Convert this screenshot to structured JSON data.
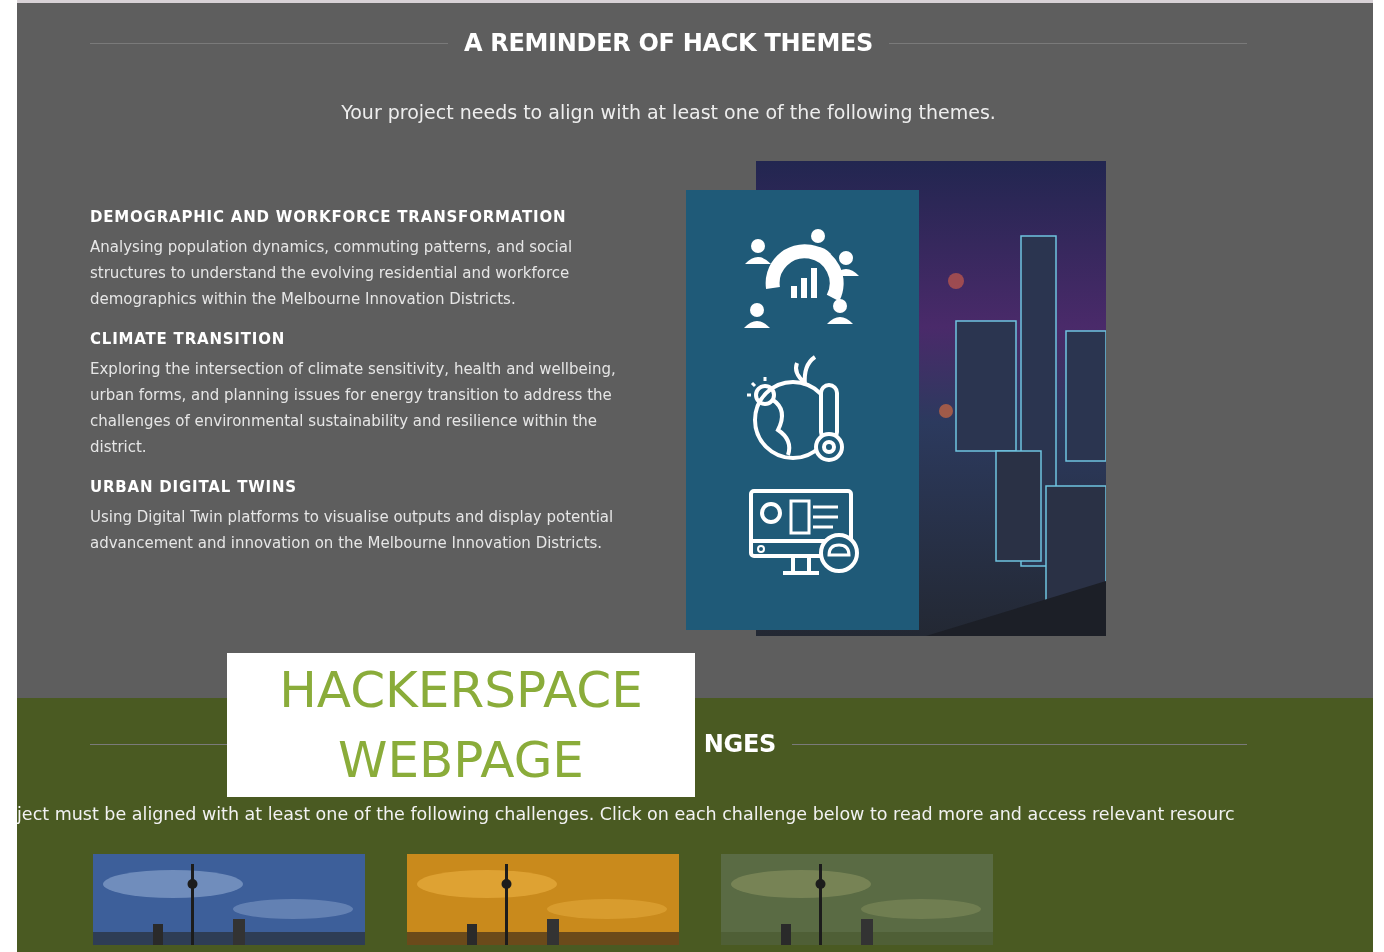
{
  "themes_section": {
    "heading": "A REMINDER OF HACK THEMES",
    "intro": "Your project needs to align with at least one of the following themes.",
    "themes": [
      {
        "title": "DEMOGRAPHIC AND WORKFORCE TRANSFORMATION",
        "text": "Analysing population dynamics, commuting patterns, and social structures to understand the evolving residential and workforce demographics within the Melbourne Innovation Districts."
      },
      {
        "title": "CLIMATE TRANSITION",
        "text": "Exploring the intersection of climate sensitivity, health and wellbeing, urban forms, and planning issues for energy transition to address the challenges of environmental sustainability and resilience within the district."
      },
      {
        "title": "URBAN DIGITAL TWINS",
        "text": "Using Digital Twin platforms to visualise outputs and display potential advancement and innovation on the Melbourne Innovation Districts."
      }
    ]
  },
  "challenges_section": {
    "heading": "NGES",
    "intro": "ject must be aligned with at least one of the following challenges. Click on each challenge below to read more and access relevant resourc"
  },
  "overlay_label": {
    "lines": [
      "HACKERSPACE",
      "WEBPAGE"
    ]
  }
}
